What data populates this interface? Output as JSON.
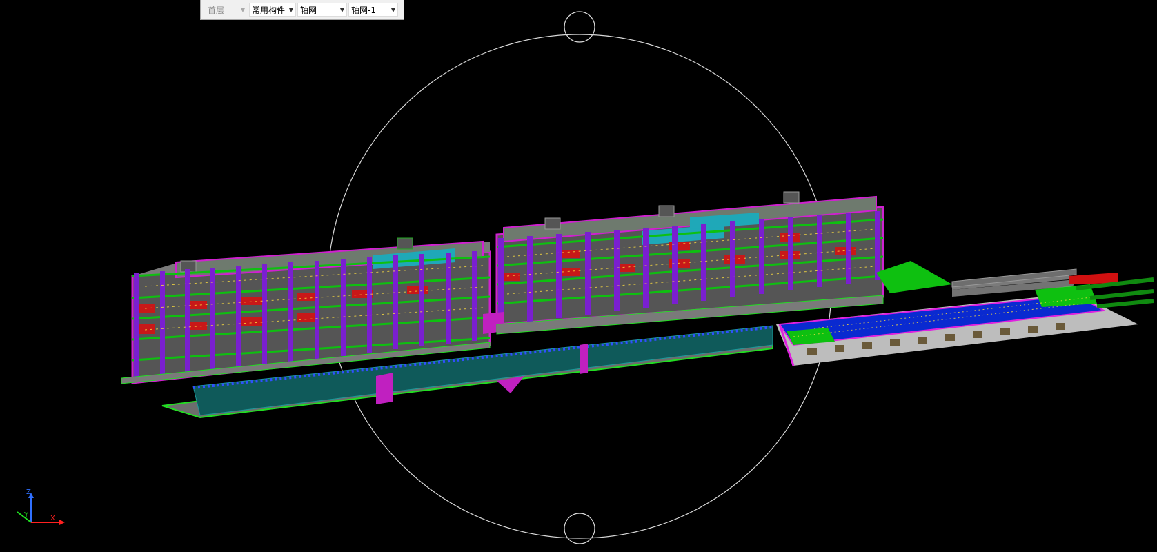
{
  "toolbar": {
    "floor": "首层",
    "component_type": "常用构件",
    "category": "轴网",
    "element": "轴网-1"
  },
  "axis_labels": {
    "z": "Z",
    "y": "Y",
    "x": "X"
  },
  "icons": {
    "dropdown": "chevron-down-icon",
    "orbit": "orbit-ring-icon",
    "axes": "xyz-axis-triad-icon"
  },
  "colors": {
    "background": "#000000",
    "orbit": "#d8d8d8",
    "axis_x": "#ff2020",
    "axis_y": "#20e020",
    "axis_z": "#3070ff",
    "beam_magenta": "#d020d0",
    "column_purple": "#7a1fd0",
    "slab_gray": "#8a8a8a",
    "wall_green": "#10b010",
    "slab_blue": "#0a2ad0",
    "accent_red": "#d01010",
    "teal_wall": "#0f6a6a"
  }
}
